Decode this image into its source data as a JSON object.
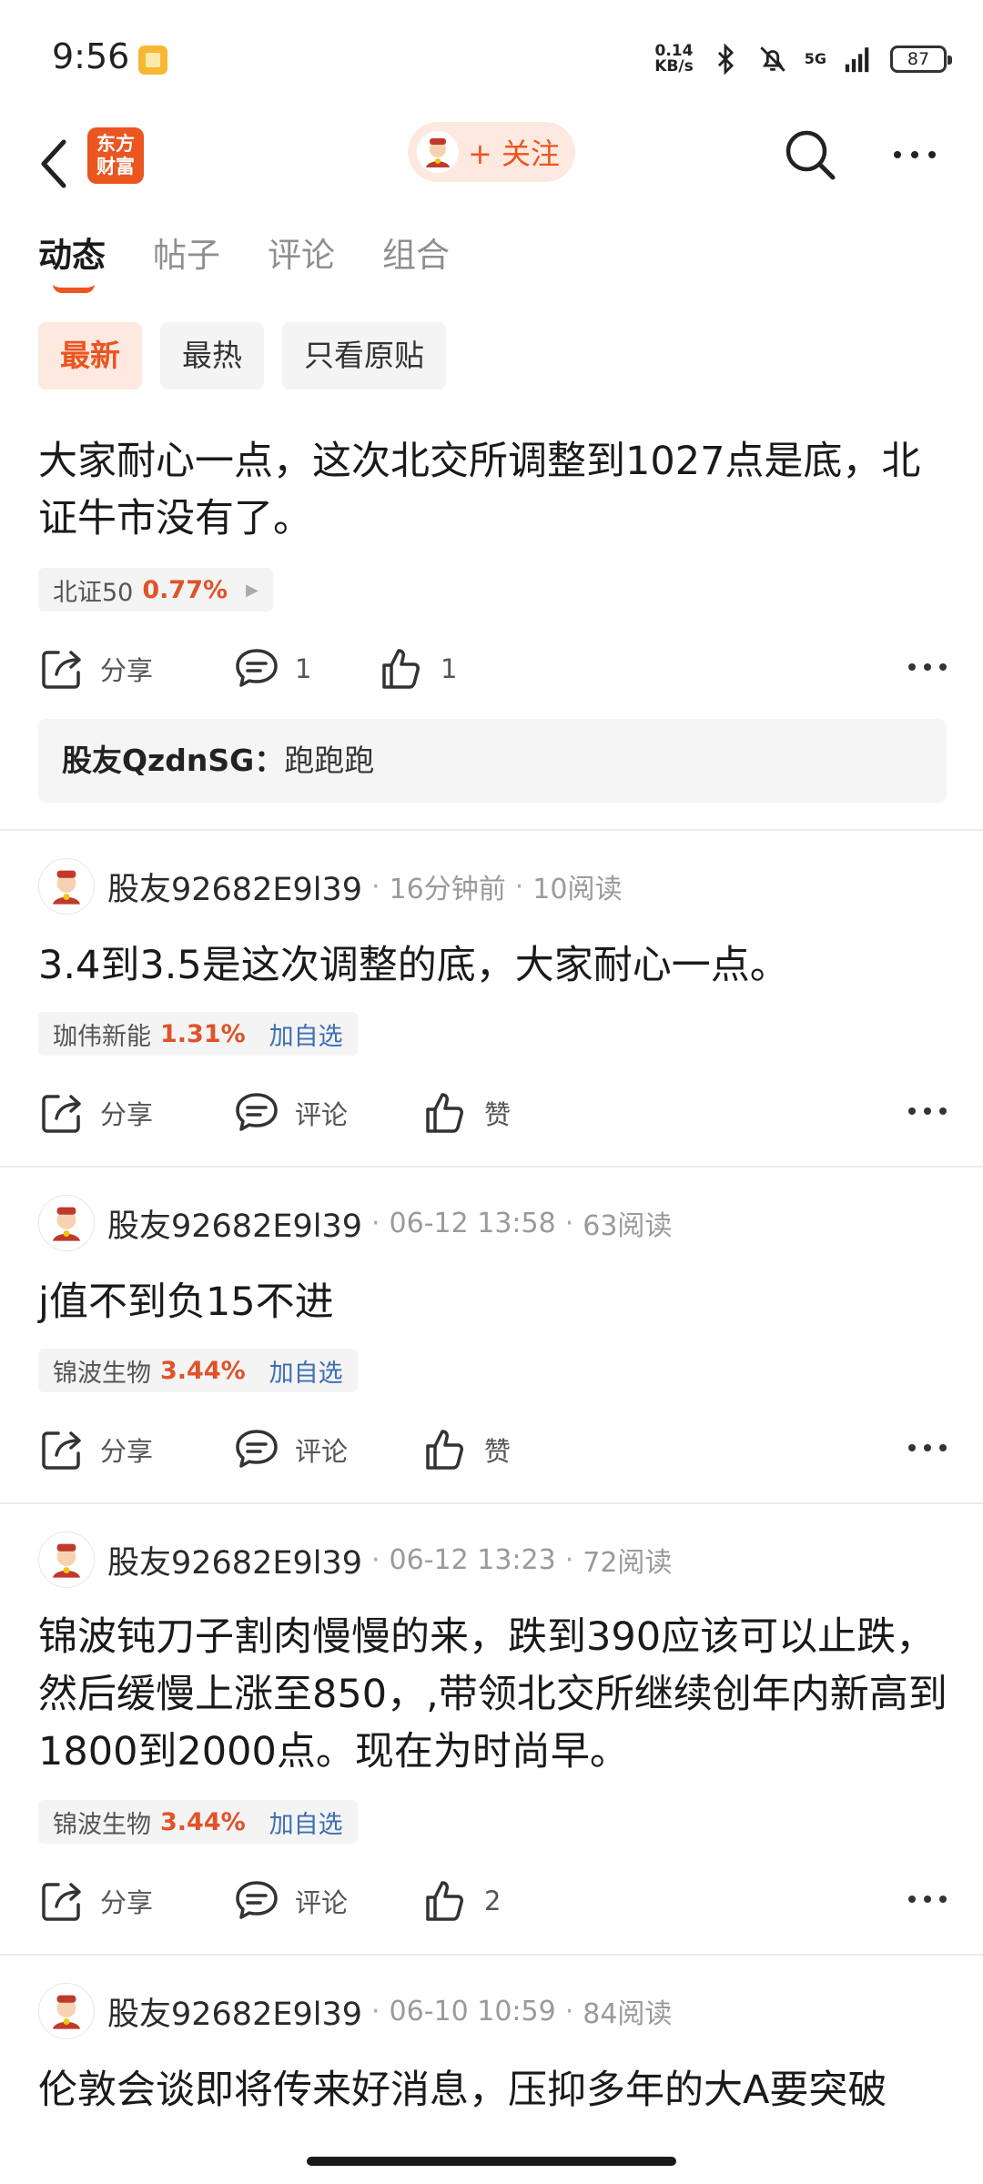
{
  "status_bar": {
    "time": "9:56",
    "net_speed_value": "0.14",
    "net_speed_unit": "KB/s",
    "network": "5G",
    "battery": "87"
  },
  "header": {
    "logo_line1": "东方",
    "logo_line2": "财富",
    "follow_label": "+ 关注"
  },
  "tabs": [
    {
      "label": "动态",
      "active": true
    },
    {
      "label": "帖子",
      "active": false
    },
    {
      "label": "评论",
      "active": false
    },
    {
      "label": "组合",
      "active": false
    }
  ],
  "filters": [
    {
      "label": "最新",
      "active": true
    },
    {
      "label": "最热",
      "active": false
    },
    {
      "label": "只看原贴",
      "active": false
    }
  ],
  "posts": [
    {
      "text": "大家耐心一点，这次北交所调整到1027点是底，北证牛市没有了。",
      "stock_name": "北证50",
      "stock_pct": "0.77%",
      "share_label": "分享",
      "comment_label": "1",
      "like_label": "1",
      "comment_user": "股友QzdnSG：",
      "comment_text": "跑跑跑"
    },
    {
      "author": "股友92682E9l39",
      "time": "16分钟前",
      "reads": "10阅读",
      "text": "3.4到3.5是这次调整的底，大家耐心一点。",
      "stock_name": "珈伟新能",
      "stock_pct": "1.31%",
      "stock_add": "加自选",
      "share_label": "分享",
      "comment_label": "评论",
      "like_label": "赞"
    },
    {
      "author": "股友92682E9l39",
      "time": "06-12 13:58",
      "reads": "63阅读",
      "text": "j值不到负15不进",
      "stock_name": "锦波生物",
      "stock_pct": "3.44%",
      "stock_add": "加自选",
      "share_label": "分享",
      "comment_label": "评论",
      "like_label": "赞"
    },
    {
      "author": "股友92682E9l39",
      "time": "06-12 13:23",
      "reads": "72阅读",
      "text": "锦波钝刀子割肉慢慢的来，跌到390应该可以止跌，然后缓慢上涨至850，,带领北交所继续创年内新高到1800到2000点。现在为时尚早。",
      "stock_name": "锦波生物",
      "stock_pct": "3.44%",
      "stock_add": "加自选",
      "share_label": "分享",
      "comment_label": "评论",
      "like_label": "2"
    },
    {
      "author": "股友92682E9l39",
      "time": "06-10 10:59",
      "reads": "84阅读",
      "text": "伦敦会谈即将传来好消息，压抑多年的大A要突破"
    }
  ]
}
